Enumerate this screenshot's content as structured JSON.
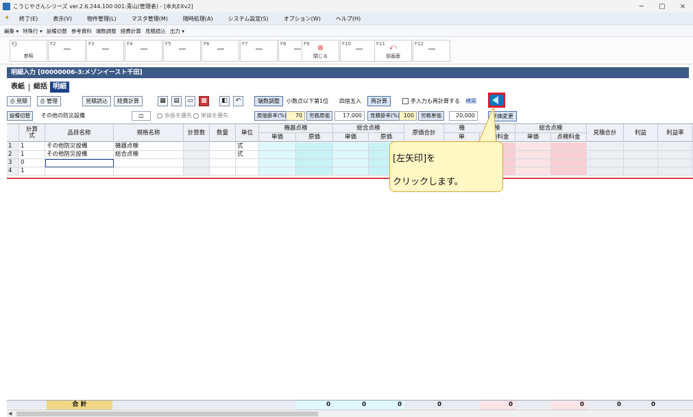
{
  "window": {
    "title": "こうじやさんシリーズ  ver.2.6.244.100  001:青山(管理者) - [本丸EXv2]",
    "minimize": "−",
    "maximize": "▢",
    "close": "×"
  },
  "menu": {
    "items": [
      "終了(E)",
      "表示(V)",
      "物件管理(L)",
      "マスタ管理(M)",
      "随時処理(A)",
      "システム設定(S)",
      "オプション(W)",
      "ヘルプ(H)"
    ]
  },
  "subtoolbar": {
    "items": [
      "編集 ▾",
      "特殊行 ▾",
      "設備切替",
      "参考資料",
      "端数調整",
      "経費計算",
      "見積読込",
      "出力 ▾"
    ]
  },
  "fkeys": [
    {
      "name": "F1",
      "label": "参照"
    },
    {
      "name": "F2",
      "label": ""
    },
    {
      "name": "F3",
      "label": ""
    },
    {
      "name": "F4",
      "label": ""
    },
    {
      "name": "F5",
      "label": ""
    },
    {
      "name": "F6",
      "label": ""
    },
    {
      "name": "F7",
      "label": ""
    },
    {
      "name": "F8",
      "label": ""
    },
    {
      "name": "F9",
      "label": "閉じる"
    },
    {
      "name": "F10",
      "label": ""
    },
    {
      "name": "F11",
      "label": "前画面"
    },
    {
      "name": "F12",
      "label": ""
    }
  ],
  "section": {
    "title": "明細入力  [00000006-3:メゾンイースト千田]"
  },
  "tabs": [
    "表紙",
    "総括",
    "明細"
  ],
  "toolbar": {
    "print_estimate": "見積",
    "print_manage": "管理",
    "read_estimate": "見積読込",
    "expense_calc": "経費計算",
    "round_adjust": "端数調整",
    "decimal_label": "小数点以下第1位",
    "rounding_label": "四捨五入",
    "recalc": "再計算",
    "recalc_manual_label": "手入力も再計算する",
    "detail_link": "横開"
  },
  "row2": {
    "equipment_switch": "設備切替",
    "equipment_name": "その他の防災設備",
    "book_icon": "◫",
    "radio_labor": "歩掛を優先",
    "radio_unit": "単価を優先",
    "cost_rate_label": "原価掛率(%)",
    "cost_rate_value": "70",
    "labor_cost_label": "労務原価",
    "labor_cost_value": "17,000",
    "estimate_rate_label": "見積掛率(%)",
    "estimate_rate_value": "100",
    "labor_unit_label": "労務単価",
    "labor_unit_value": "20,000",
    "unit_change": "単価変更"
  },
  "grid": {
    "headers": {
      "calc": "計算\n式",
      "item_name": "品目名称",
      "spec_name": "規格名称",
      "calc_qty": "計算数",
      "qty": "数量",
      "unit": "単位",
      "equip_group": "機器点検",
      "unit_price": "単価",
      "cost_price": "原価",
      "total_group": "総合点検",
      "cost_total": "原価合計",
      "group3_a": "機",
      "group3_b": "検",
      "unit_short": "単",
      "inspection_fee": "点検料金",
      "total_group2": "総合点検",
      "unit_price2": "単価",
      "inspection_fee2": "点検料金",
      "estimate_total": "見積合計",
      "profit": "利益",
      "profit_rate": "利益率"
    },
    "rows": [
      {
        "no": "1",
        "calc": "1",
        "item": "その他防災設備",
        "spec": "機器点検",
        "unit": "式"
      },
      {
        "no": "2",
        "calc": "1",
        "item": "その他防災設備",
        "spec": "総合点検",
        "unit": "式"
      },
      {
        "no": "3",
        "calc": "0",
        "item": "",
        "spec": "",
        "unit": ""
      },
      {
        "no": "4",
        "calc": "1",
        "item": "",
        "spec": "",
        "unit": ""
      }
    ]
  },
  "totals": {
    "label": "合 計",
    "values": [
      "0",
      "0",
      "0",
      "0",
      "0",
      "0",
      "0",
      "0"
    ]
  },
  "callout": {
    "line1": "[左矢印]を",
    "line2": "クリックします。"
  },
  "colors": {
    "header": "#3c5a86",
    "highlight": "#e0182a",
    "callout_bg": "#fff7c4"
  }
}
